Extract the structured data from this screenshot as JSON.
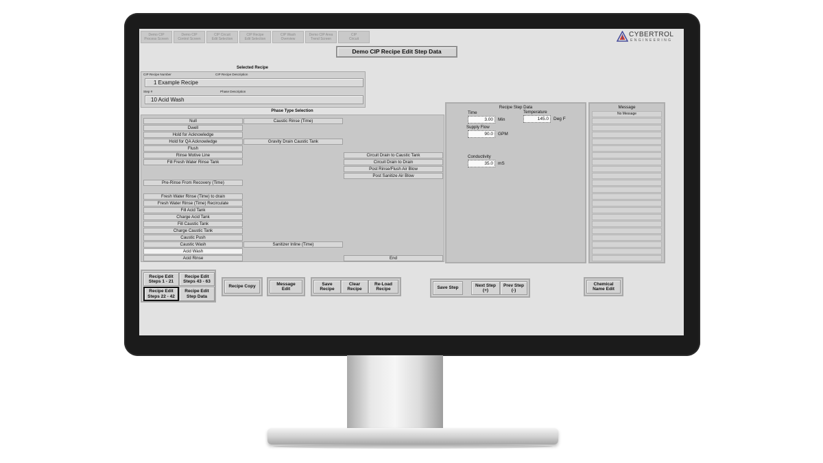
{
  "nav_tabs": [
    {
      "label": "Demo CIP\nProcess Screen"
    },
    {
      "label": "Demo CIP\nControl Screen"
    },
    {
      "label": "CIP Circuit\nEdit Selection"
    },
    {
      "label": "CIP Recipe\nEdit Selection"
    },
    {
      "label": "CIP Wash\nOverview"
    },
    {
      "label": "Demo CIP Area\nTrend Screen"
    },
    {
      "label": "CIP\nCircuit"
    }
  ],
  "logo": {
    "title": "CYBERTROL",
    "subtitle": "ENGINEERING",
    "color": "#4a4f9b"
  },
  "page_title": "Demo CIP Recipe Edit Step Data",
  "selected_recipe": {
    "heading": "Selected Recipe",
    "recipe_number_label": "CIP Recipe Number",
    "recipe_desc_label": "CIP Recipe Description",
    "recipe_value": "1   Example Recipe",
    "step_label": "Step #",
    "phase_desc_label": "Phase Description",
    "step_value": "10   Acid Wash"
  },
  "phase_selection": {
    "heading": "Phase Type Selection",
    "col1": [
      "Null",
      "Dwell",
      "Hold for Acknowledge",
      "Hold for QA Acknowledge",
      "Flush",
      "Rinse Motive Line",
      "Fill Fresh Water Rinse Tank",
      "",
      "",
      "Pre-Rinse From Recovery (Time)",
      "",
      "Fresh Water Rinse (Time) to drain",
      "Fresh Water Rinse (Time) Recirculate",
      "Fill Acid Tank",
      "Charge Acid Tank",
      "Fill Caustic Tank",
      "Charge Caustic Tank",
      "Caustic Push",
      "Caustic Wash",
      "Acid Wash",
      "Acid Rinse"
    ],
    "col1_selected_index": 19,
    "col2": [
      "Caustic Rinse (Time)",
      "",
      "",
      "Gravity Drain Caustic Tank",
      "",
      "",
      "",
      "",
      "",
      "",
      "",
      "",
      "",
      "",
      "",
      "",
      "",
      "",
      "Sanitizer Inline (Time)",
      "",
      ""
    ],
    "col3": [
      "",
      "",
      "",
      "",
      "",
      "Circuit Drain to Caustic Tank",
      "Circuit Drain to Drain",
      "Post Rinse/Flush Air Blow",
      "Post Sanitize Air Blow",
      "",
      "",
      "",
      "",
      "",
      "",
      "",
      "",
      "",
      "",
      "",
      "End"
    ]
  },
  "step_data": {
    "heading": "Recipe Step Data",
    "time_label": "Time",
    "time_value": "3.00",
    "time_unit": "Min",
    "temp_label": "Temperature",
    "temp_value": "145.0",
    "temp_unit": "Deg F",
    "flow_label": "Supply Flow",
    "flow_value": "90.0",
    "flow_unit": "GPM",
    "cond_label": "Conductivity",
    "cond_value": "35.0",
    "cond_unit": "mS"
  },
  "message_panel": {
    "heading": "Message",
    "first": "No Message"
  },
  "buttons": {
    "steps_1_21": "Recipe Edit\nSteps 1 - 21",
    "steps_43_63": "Recipe Edit\nSteps 43 - 63",
    "steps_22_42": "Recipe Edit\nSteps 22 - 42",
    "step_data": "Recipe Edit\nStep Data",
    "recipe_copy": "Recipe Copy",
    "message_edit": "Message\nEdit",
    "save_recipe": "Save\nRecipe",
    "clear_recipe": "Clear\nRecipe",
    "reload_recipe": "Re-Load\nRecipe",
    "save_step": "Save Step",
    "next_step": "Next Step\n(+)",
    "prev_step": "Prev Step\n(-)",
    "chemical_name_edit": "Chemical\nName Edit"
  }
}
